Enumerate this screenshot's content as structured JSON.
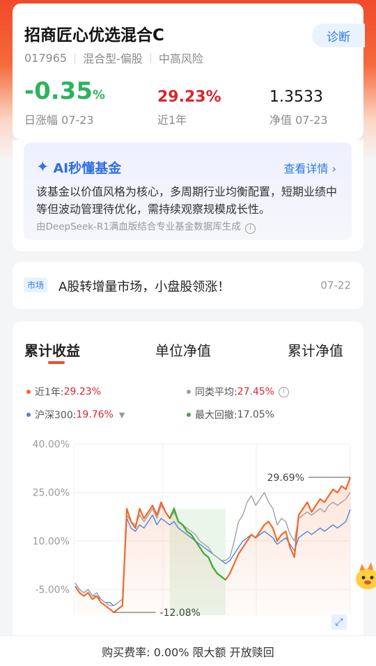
{
  "fund": {
    "name": "招商匠心优选混合C",
    "code": "017965",
    "type": "混合型-偏股",
    "risk": "中高风险",
    "diagnose_label": "诊断"
  },
  "stats": {
    "day_change": "-0.35",
    "day_change_unit": "%",
    "day_change_label": "日涨幅 07-23",
    "year_return": "29.23%",
    "year_return_label": "近1年",
    "nav": "1.3533",
    "nav_label": "净值 07-23"
  },
  "ai": {
    "title": "AI秒懂基金",
    "more": "查看详情 ›",
    "body": "该基金以价值风格为核心，多周期行业均衡配置，短期业绩中等但波动管理待优化，需持续观察规模成长性。",
    "source": "由DeepSeek-R1满血版结合专业基金数据库生成"
  },
  "news": {
    "tag": "市场",
    "text": "A股转增量市场，小盘股领涨！",
    "date": "07-22"
  },
  "tabs": [
    "累计收益",
    "单位净值",
    "累计净值"
  ],
  "legend": {
    "fund_label": "近1年:",
    "fund_value": "29.23%",
    "peer_label": "同类平均:",
    "peer_value": "27.45%",
    "index_label": "沪深300:",
    "index_value": "19.76%",
    "drawdown_label": "最大回撤:",
    "drawdown_value": "17.05%"
  },
  "colors": {
    "fund": "#f0682c",
    "peer": "#a0a0a0",
    "index": "#4a86d8",
    "drawdown": "#3cab3c",
    "up": "#d9262d",
    "down": "#2eb35c",
    "accent": "#2f7bd9"
  },
  "chart_data": {
    "type": "line",
    "y_ticks": [
      "40.00%",
      "25.00%",
      "10.00%",
      "-5.00%"
    ],
    "ylim": [
      -12.08,
      40
    ],
    "annotations": {
      "max_label": "29.69%",
      "min_label": "-12.08%"
    },
    "series": [
      {
        "name": "近1年",
        "values": [
          -4,
          -6,
          -7,
          -6,
          -8,
          -7,
          -9,
          -10,
          -11,
          -12.08,
          -11,
          -10,
          20,
          16,
          14,
          20,
          17,
          19,
          21,
          18,
          22,
          19,
          17,
          20,
          16,
          15,
          13,
          12,
          10,
          8,
          6,
          5,
          2,
          0,
          -1,
          -2,
          0,
          3,
          6,
          8,
          10,
          12,
          11,
          13,
          15,
          16,
          14,
          10,
          12,
          13,
          8,
          5,
          18,
          20,
          22,
          19,
          21,
          23,
          22,
          24,
          26,
          25,
          27,
          26,
          29.69
        ]
      },
      {
        "name": "同类平均",
        "values": [
          -3,
          -5,
          -6,
          -5,
          -7,
          -6,
          -8,
          -9,
          -10,
          -10,
          -9,
          -8,
          18,
          16,
          15,
          18,
          16,
          18,
          20,
          17,
          21,
          19,
          17,
          19,
          16,
          15,
          14,
          13,
          12,
          10,
          9,
          8,
          6,
          5,
          4,
          4,
          5,
          10,
          16,
          18,
          22,
          24,
          21,
          23,
          25,
          22,
          20,
          15,
          17,
          16,
          12,
          10,
          17,
          18,
          19,
          18,
          19,
          20,
          19,
          21,
          22,
          21,
          22,
          23,
          25
        ]
      },
      {
        "name": "沪深300",
        "values": [
          -3,
          -5,
          -6,
          -5,
          -7,
          -7,
          -8,
          -9,
          -9,
          -10,
          -9,
          -8,
          17,
          14,
          13,
          15,
          14,
          16,
          18,
          15,
          17,
          16,
          15,
          16,
          14,
          13,
          12,
          11,
          10,
          9,
          8,
          7,
          6,
          5,
          4,
          3,
          4,
          6,
          8,
          10,
          11,
          12,
          11,
          12,
          13,
          12,
          11,
          9,
          10,
          11,
          9,
          7,
          11,
          12,
          13,
          12,
          13,
          14,
          13,
          14,
          15,
          14,
          15,
          16,
          19.76
        ]
      }
    ]
  },
  "bottom": {
    "fee_text": "购买费率: 0.00% 限大额 开放赎回"
  }
}
